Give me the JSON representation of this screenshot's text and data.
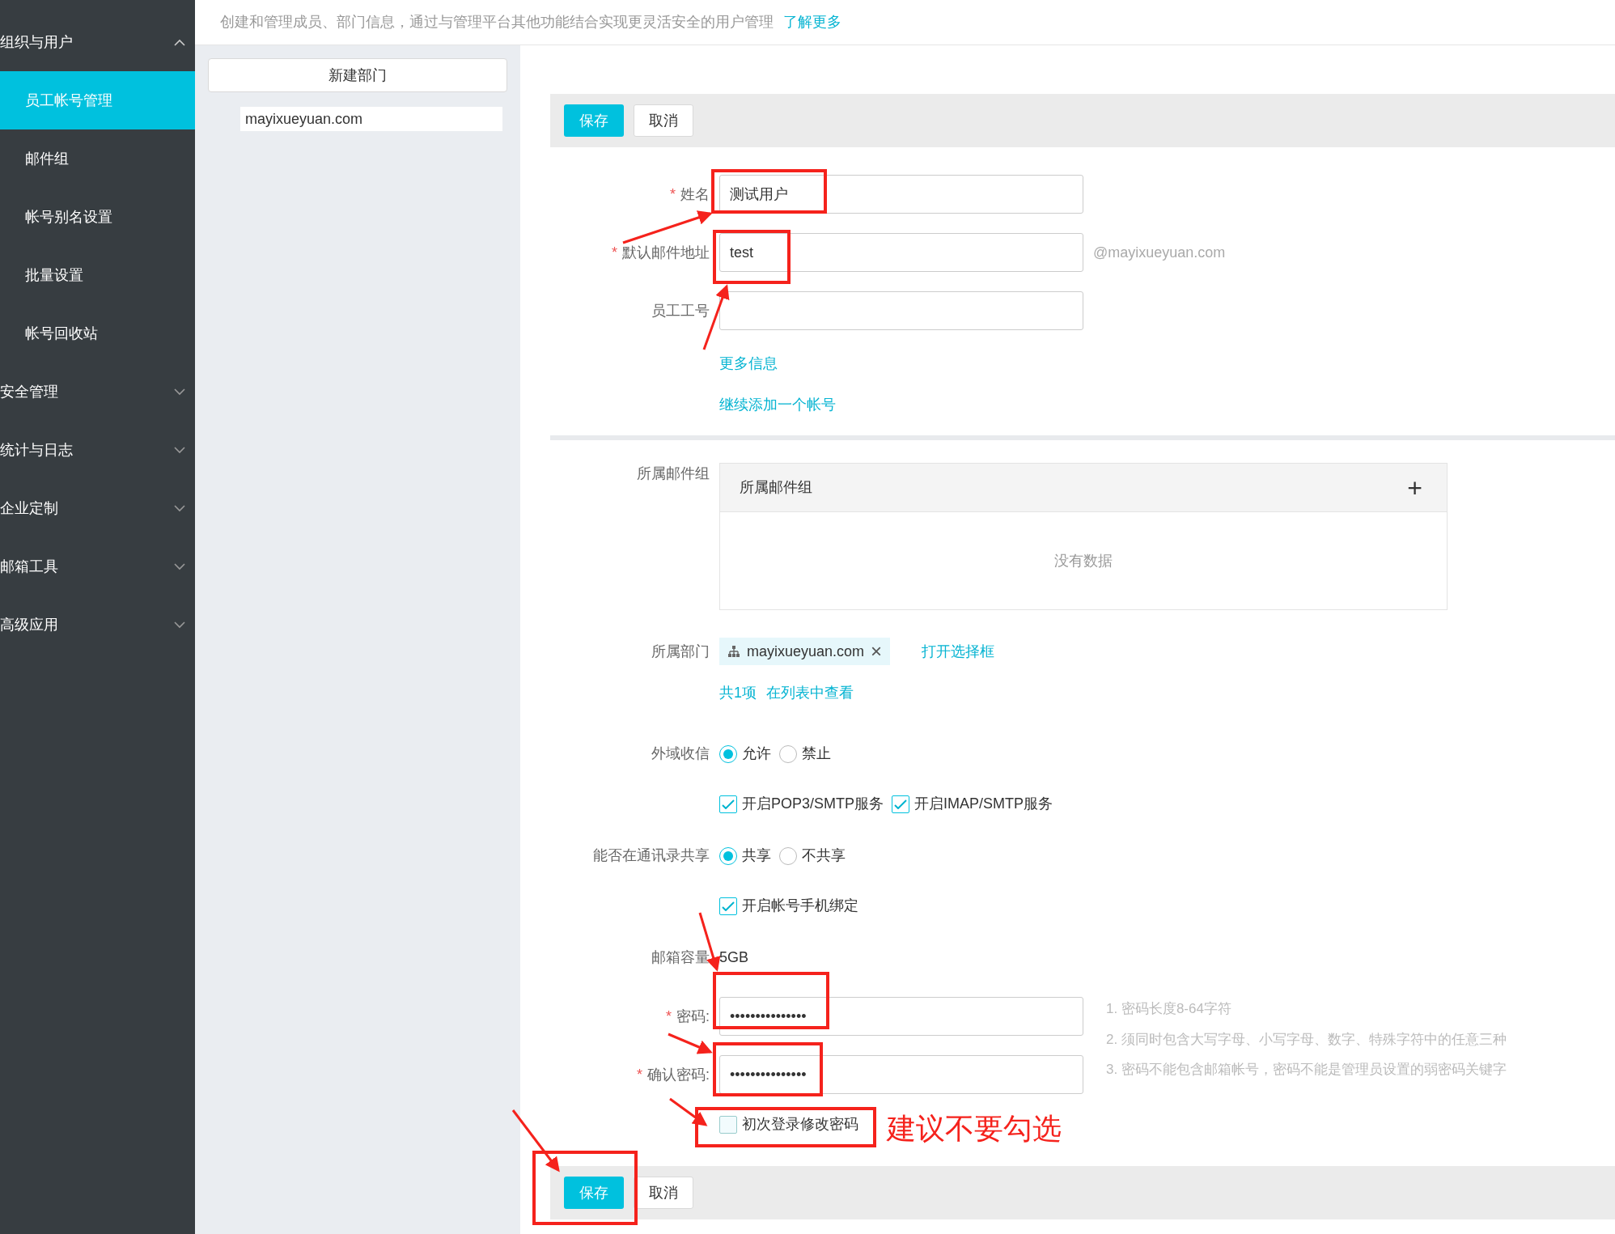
{
  "sidebar": {
    "groups": [
      {
        "label": "组织与用户",
        "expanded": true,
        "children": [
          {
            "label": "员工帐号管理",
            "selected": true
          },
          {
            "label": "邮件组",
            "selected": false
          },
          {
            "label": "帐号别名设置",
            "selected": false
          },
          {
            "label": "批量设置",
            "selected": false
          },
          {
            "label": "帐号回收站",
            "selected": false
          }
        ]
      },
      {
        "label": "安全管理",
        "expanded": false
      },
      {
        "label": "统计与日志",
        "expanded": false
      },
      {
        "label": "企业定制",
        "expanded": false
      },
      {
        "label": "邮箱工具",
        "expanded": false
      },
      {
        "label": "高级应用",
        "expanded": false
      }
    ]
  },
  "description": {
    "text": "创建和管理成员、部门信息，通过与管理平台其他功能结合实现更灵活安全的用户管理",
    "link": "了解更多"
  },
  "departments": {
    "new_button": "新建部门",
    "items": [
      {
        "label": "mayixueyuan.com",
        "selected": true
      }
    ]
  },
  "toolbar_top": {
    "save": "保存",
    "cancel": "取消"
  },
  "form": {
    "fields": [
      {
        "label": "姓名",
        "required": true,
        "value": "测试用户"
      },
      {
        "label": "默认邮件地址",
        "required": true,
        "value": "test",
        "suffix": "@mayixueyuan.com"
      },
      {
        "label": "员工工号",
        "required": false
      }
    ],
    "links": [
      "更多信息",
      "继续添加一个帐号"
    ],
    "mail_groups": {
      "label": "所属邮件组",
      "header": "所属邮件组",
      "add": "+",
      "empty": "没有数据"
    },
    "department": {
      "label": "所属部门",
      "tag": "mayixueyuan.com",
      "remove": "×",
      "open": "打开选择框",
      "count": "共1项",
      "view": "在列表中查看"
    },
    "external": {
      "label": "外域收信",
      "options": [
        {
          "label": "允许",
          "selected": true
        },
        {
          "label": "禁止",
          "selected": false
        }
      ]
    },
    "services": [
      {
        "label": "开启POP3/SMTP服务",
        "checked": true
      },
      {
        "label": "开启IMAP/SMTP服务",
        "checked": true
      }
    ],
    "share": {
      "label": "能否在通讯录共享",
      "options": [
        {
          "label": "共享",
          "selected": true
        },
        {
          "label": "不共享",
          "selected": false
        }
      ]
    },
    "phone_binding": {
      "label": "开启帐号手机绑定",
      "checked": true
    },
    "capacity": {
      "label": "邮箱容量",
      "value": "5GB"
    },
    "password": {
      "label": "密码:",
      "required": true,
      "value": "•••••••••••••••"
    },
    "confirm": {
      "label": "确认密码:",
      "required": true,
      "value": "•••••••••••••••"
    },
    "rules": [
      "1. 密码长度8-64字符",
      "2. 须同时包含大写字母、小写字母、数字、特殊字符中的任意三种",
      "3. 密码不能包含邮箱帐号，密码不能是管理员设置的弱密码关键字"
    ],
    "first_login": {
      "label": "初次登录修改密码",
      "checked": false
    }
  },
  "toolbar_bottom": {
    "save": "保存",
    "cancel": "取消"
  },
  "required_mark": "*",
  "annotation": {
    "note": "建议不要勾选"
  }
}
